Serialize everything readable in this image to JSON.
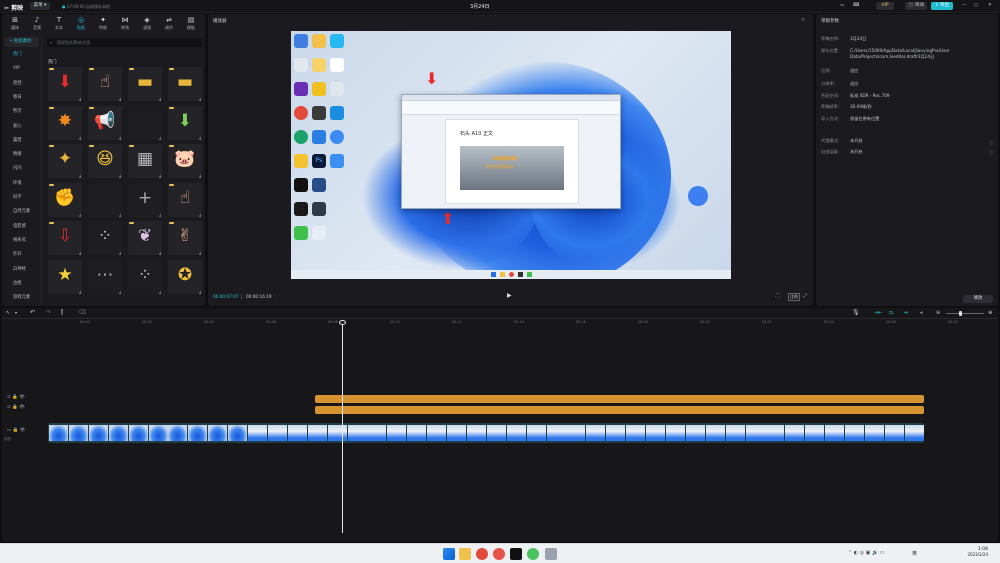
{
  "app": {
    "name": "剪映",
    "menu_label": "菜单",
    "autosave": "17:09:00 自动保存本地",
    "project_title": "3月24日",
    "vip_label": "VIP",
    "shortcut_label": "快捷键",
    "review_label": "审阅",
    "export_label": "导出"
  },
  "toolbar": [
    {
      "label": "媒体",
      "icon": "media-icon"
    },
    {
      "label": "音频",
      "icon": "audio-icon"
    },
    {
      "label": "文本",
      "icon": "text-icon"
    },
    {
      "label": "贴纸",
      "icon": "sticker-icon"
    },
    {
      "label": "特效",
      "icon": "effects-icon"
    },
    {
      "label": "转场",
      "icon": "transition-icon"
    },
    {
      "label": "滤镜",
      "icon": "filter-icon"
    },
    {
      "label": "调节",
      "icon": "adjust-icon"
    },
    {
      "label": "模板",
      "icon": "template-icon"
    }
  ],
  "sticker_panel": {
    "top_button": "• 贴纸素材",
    "search_placeholder": "搜索贴纸素材/文案",
    "section_title": "热门",
    "categories": [
      "热门",
      "VIP",
      "遮挡",
      "春日",
      "熊示",
      "爱心",
      "露营",
      "情绪",
      "闪闪",
      "环境",
      "科学",
      "自然元素",
      "电影感",
      "线条风",
      "炸开",
      "白神经",
      "边框",
      "游戏元素"
    ],
    "stickers": [
      {
        "kind": "arrow-down-red"
      },
      {
        "kind": "hand-point"
      },
      {
        "kind": "gold-text-1"
      },
      {
        "kind": "gold-text-2"
      },
      {
        "kind": "burst-text"
      },
      {
        "kind": "megaphone"
      },
      {
        "kind": "empty-dark"
      },
      {
        "kind": "arrow-green"
      },
      {
        "kind": "like-text"
      },
      {
        "kind": "laughing-emoji"
      },
      {
        "kind": "mosaic"
      },
      {
        "kind": "pig"
      },
      {
        "kind": "fist"
      },
      {
        "kind": "empty-dark"
      },
      {
        "kind": "sparkle-dark"
      },
      {
        "kind": "hand-point-2"
      },
      {
        "kind": "arrow-down-outline"
      },
      {
        "kind": "sparkle-dots"
      },
      {
        "kind": "butterfly"
      },
      {
        "kind": "hand-66"
      },
      {
        "kind": "star-yellow"
      },
      {
        "kind": "dots-dark"
      },
      {
        "kind": "sparkle-dots-2"
      },
      {
        "kind": "cartoon-text"
      }
    ]
  },
  "player": {
    "title": "播放器",
    "current_time": "00:00:07:07",
    "total_time": "00:00:16:19",
    "ratio_label": "比例",
    "word_window": {
      "doc_title": "石头 A10 正文",
      "overlay_text_1": "2K屏超详细",
      "overlay_text_2": "附各国详细版本"
    }
  },
  "details": {
    "title": "草稿参数",
    "rows": [
      {
        "label": "草稿名称:",
        "value": "3月24日"
      },
      {
        "label": "保存位置:",
        "value": "C:/Users/15069/AppData/Local/JianyingPro/User Data/Projects/com.lveditor.draft/3月24日"
      },
      {
        "label": "比例:",
        "value": "适应"
      },
      {
        "label": "分辨率:",
        "value": "适应"
      },
      {
        "label": "色彩空间:",
        "value": "标准 SDR - Rec.709"
      },
      {
        "label": "草稿帧率:",
        "value": "30.00帧/秒"
      },
      {
        "label": "导入方式:",
        "value": "保留在原有位置"
      },
      {
        "label": "代理模式:",
        "value": "未开启"
      },
      {
        "label": "自由层级:",
        "value": "未开启"
      }
    ],
    "modify_button": "修改"
  },
  "timeline": {
    "ruler_ticks": [
      "00:00",
      "00:02",
      "00:04",
      "00:06",
      "00:08",
      "00:10",
      "00:12",
      "00:14",
      "00:16",
      "00:18",
      "00:20",
      "00:22",
      "00:24",
      "00:26",
      "00:28",
      "00:30"
    ],
    "cover_label": "封面"
  },
  "windows_taskbar": {
    "time": "1:08",
    "date": "2023/3/24",
    "lang": "英"
  }
}
